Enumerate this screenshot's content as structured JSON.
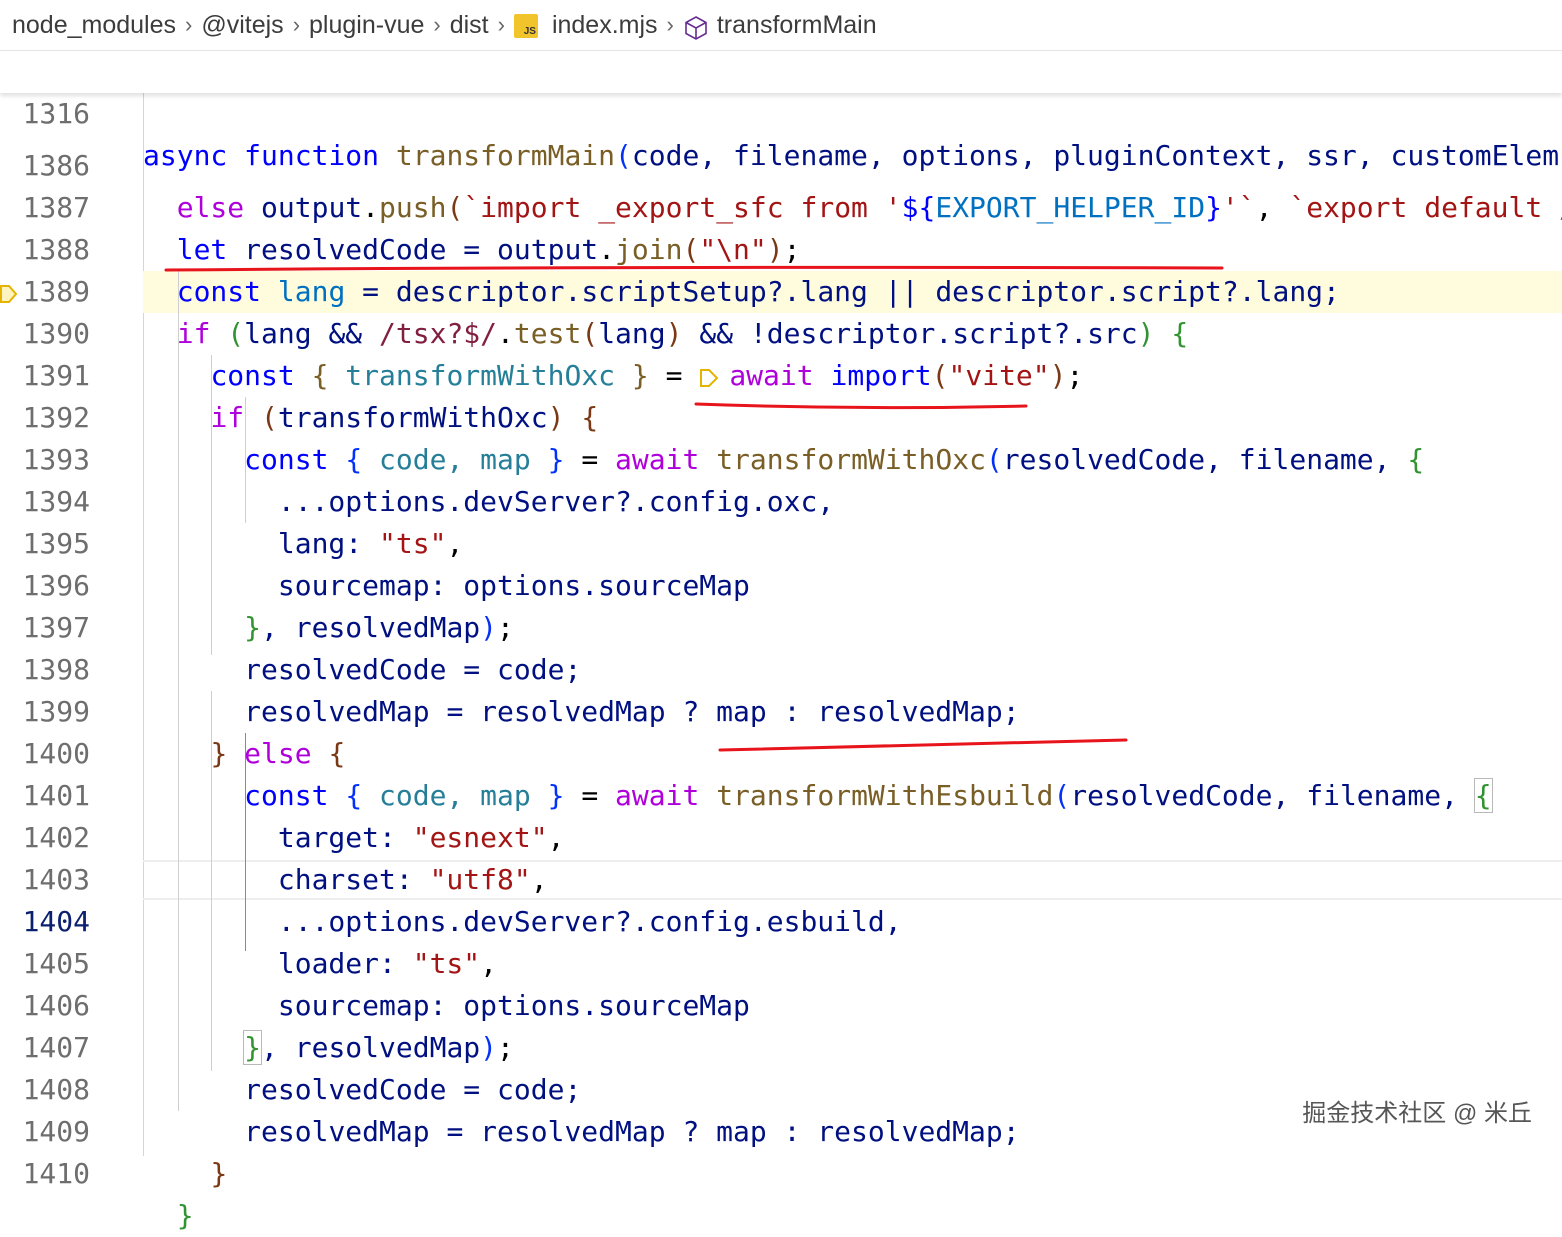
{
  "breadcrumb": {
    "items": [
      "node_modules",
      "@vitejs",
      "plugin-vue",
      "dist",
      "index.mjs",
      "transformMain"
    ],
    "file_icon": "js-file-icon",
    "symbol_icon": "method-cube-icon"
  },
  "sticky": {
    "line_number": "1316",
    "tokens": {
      "async": "async",
      "function": "function",
      "name": "transformMain",
      "open": "(",
      "params": "code, filename, options, pluginContext, ssr, customElem"
    }
  },
  "lines": {
    "n1386": "1386",
    "n1387": "1387",
    "n1388": "1388",
    "n1389": "1389",
    "n1390": "1390",
    "n1391": "1391",
    "n1392": "1392",
    "n1393": "1393",
    "n1394": "1394",
    "n1395": "1395",
    "n1396": "1396",
    "n1397": "1397",
    "n1398": "1398",
    "n1399": "1399",
    "n1400": "1400",
    "n1401": "1401",
    "n1402": "1402",
    "n1403": "1403",
    "n1404": "1404",
    "n1405": "1405",
    "n1406": "1406",
    "n1407": "1407",
    "n1408": "1408",
    "n1409": "1409",
    "n1410": "1410"
  },
  "code": {
    "l1386": {
      "else": "else",
      "output": "output",
      "dot": ".",
      "push": "push",
      "open": "(",
      "tpl": "`import _export_sfc from '",
      "interp_open": "${",
      "helper": "EXPORT_HELPER_ID",
      "interp_close": "}",
      "tpl_end": "'`",
      "comma": ", ",
      "tpl2": "`export default /"
    },
    "l1387": {
      "let": "let",
      "rest": " resolvedCode = ",
      "output": "output",
      "dot": ".",
      "join": "join",
      "open": "(",
      "str": "\"\\n\"",
      "close": ")",
      "semi": ";"
    },
    "l1388": {
      "const": "const",
      "lang": "lang",
      "rest": " = descriptor.scriptSetup?.lang || descriptor.script?.lang;"
    },
    "l1389": {
      "if": "if",
      "open": "(",
      "lang": "lang && ",
      "regex": "/tsx?$/",
      "dot": ".",
      "test": "test",
      "p_open": "(",
      "arg": "lang",
      "p_close": ")",
      "and": " && !descriptor.script?.src",
      "close": ")",
      "brace": "{"
    },
    "l1390": {
      "const": "const",
      "brace_open": "{",
      "name": " transformWithOxc ",
      "brace_close": "}",
      "eq": " = ",
      "await": "await",
      "import": "import",
      "open": "(",
      "str": "\"vite\"",
      "close": ")",
      "semi": ";"
    },
    "l1391": {
      "if": "if",
      "open": "(",
      "arg": "transformWithOxc",
      "close": ")",
      "brace": "{"
    },
    "l1392": {
      "const": "const",
      "brace_open": "{",
      "vars": " code, map ",
      "brace_close": "}",
      "eq": " = ",
      "await": "await",
      "fn": "transformWithOxc",
      "open": "(",
      "args": "resolvedCode, filename, ",
      "brace": "{"
    },
    "l1393": {
      "text": "...options.devServer?.config.oxc,"
    },
    "l1394": {
      "key": "lang: ",
      "str": "\"ts\"",
      "comma": ","
    },
    "l1395": {
      "text": "sourcemap: options.sourceMap"
    },
    "l1396": {
      "brace": "}",
      "rest": ", resolvedMap",
      "close": ")",
      "semi": ";"
    },
    "l1397": {
      "text": "resolvedCode = code;"
    },
    "l1398": {
      "text": "resolvedMap = resolvedMap ? map : resolvedMap;"
    },
    "l1399": {
      "brace_close": "}",
      "else": "else",
      "brace": "{"
    },
    "l1400": {
      "const": "const",
      "brace_open": "{",
      "vars": " code, map ",
      "brace_close": "}",
      "eq": " = ",
      "await": "await",
      "fn": "transformWithEsbuild",
      "open": "(",
      "args": "resolvedCode, filename, ",
      "brace": "{"
    },
    "l1401": {
      "key": "target: ",
      "str": "\"esnext\"",
      "comma": ","
    },
    "l1402": {
      "key": "charset: ",
      "str": "\"utf8\"",
      "comma": ","
    },
    "l1403": {
      "text": "...options.devServer?.config.esbuild,"
    },
    "l1404": {
      "key": "loader: ",
      "str": "\"ts\"",
      "comma": ","
    },
    "l1405": {
      "text": "sourcemap: options.sourceMap"
    },
    "l1406": {
      "brace": "}",
      "rest": ", resolvedMap",
      "close": ")",
      "semi": ";"
    },
    "l1407": {
      "text": "resolvedCode = code;"
    },
    "l1408": {
      "text": "resolvedMap = resolvedMap ? map : resolvedMap;"
    },
    "l1409": {
      "brace": "}"
    },
    "l1410": {
      "brace": "}"
    }
  },
  "colors": {
    "keyword_blue": "#0000ff",
    "control_purple": "#af00db",
    "function_brown": "#795e26",
    "string_red": "#a31515",
    "variable_navy": "#001080",
    "annotation_red": "#e8141c",
    "breakpoint_yellow": "#e5b400",
    "highlight_bg": "#fffbdd"
  },
  "watermark": "掘金技术社区 @ 米丘"
}
